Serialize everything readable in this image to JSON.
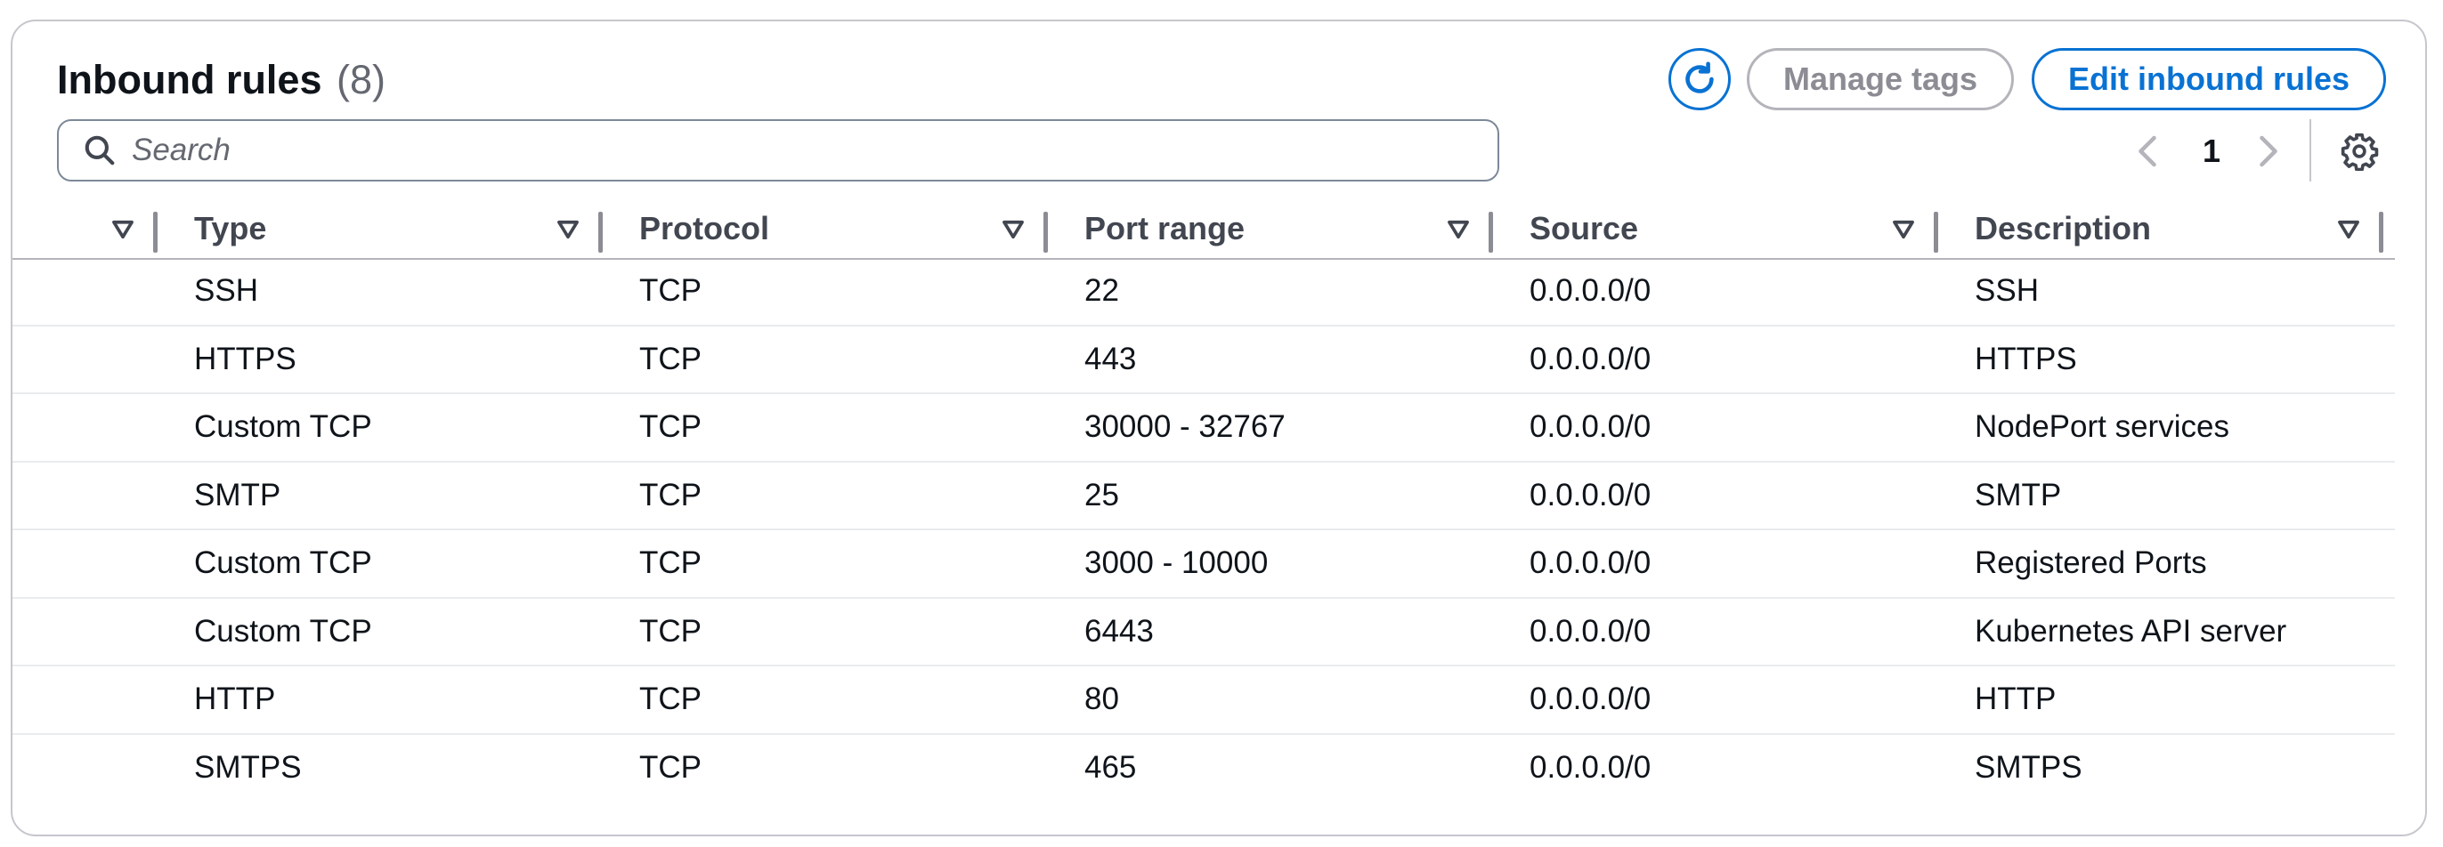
{
  "header": {
    "title": "Inbound rules",
    "count": "(8)",
    "refresh_icon": "refresh-icon",
    "manage_tags_label": "Manage tags",
    "edit_label": "Edit inbound rules",
    "accent_color": "#0972d3",
    "disabled_color": "#8c8c94"
  },
  "search": {
    "placeholder": "Search",
    "value": "",
    "icon": "search-icon"
  },
  "pagination": {
    "current_page": "1",
    "prev_icon": "chevron-left-icon",
    "next_icon": "chevron-right-icon",
    "settings_icon": "gear-icon"
  },
  "table": {
    "columns": [
      "Type",
      "Protocol",
      "Port range",
      "Source",
      "Description"
    ],
    "sort_icon": "sort-caret-down-icon",
    "rows": [
      {
        "type": "SSH",
        "protocol": "TCP",
        "port_range": "22",
        "source": "0.0.0.0/0",
        "description": "SSH"
      },
      {
        "type": "HTTPS",
        "protocol": "TCP",
        "port_range": "443",
        "source": "0.0.0.0/0",
        "description": "HTTPS"
      },
      {
        "type": "Custom TCP",
        "protocol": "TCP",
        "port_range": "30000 - 32767",
        "source": "0.0.0.0/0",
        "description": "NodePort services"
      },
      {
        "type": "SMTP",
        "protocol": "TCP",
        "port_range": "25",
        "source": "0.0.0.0/0",
        "description": "SMTP"
      },
      {
        "type": "Custom TCP",
        "protocol": "TCP",
        "port_range": "3000 - 10000",
        "source": "0.0.0.0/0",
        "description": "Registered Ports"
      },
      {
        "type": "Custom TCP",
        "protocol": "TCP",
        "port_range": "6443",
        "source": "0.0.0.0/0",
        "description": "Kubernetes API server"
      },
      {
        "type": "HTTP",
        "protocol": "TCP",
        "port_range": "80",
        "source": "0.0.0.0/0",
        "description": "HTTP"
      },
      {
        "type": "SMTPS",
        "protocol": "TCP",
        "port_range": "465",
        "source": "0.0.0.0/0",
        "description": "SMTPS"
      }
    ]
  }
}
